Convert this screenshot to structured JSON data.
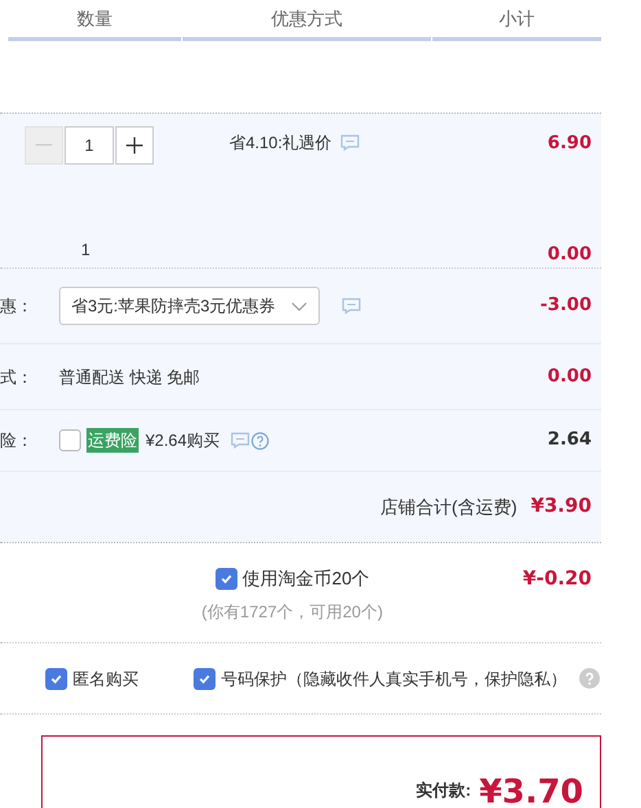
{
  "columns": [
    "数量",
    "优惠方式",
    "小计"
  ],
  "item": {
    "quantity": "1",
    "discount": "省4.10:礼遇价",
    "subtotal": "6.90"
  },
  "gift": {
    "quantity": "1",
    "subtotal": "0.00"
  },
  "coupon": {
    "label": "惠：",
    "value": "省3元:苹果防摔壳3元优惠券",
    "amount": "-3.00"
  },
  "delivery": {
    "label": "式：",
    "value": "普通配送 快递 免邮",
    "amount": "0.00"
  },
  "insurance": {
    "label": "险：",
    "checked": false,
    "badge": "运费险",
    "price": "¥2.64购买",
    "amount": "2.64"
  },
  "shop_total": {
    "label": "店铺合计(含运费)",
    "amount": "¥3.90"
  },
  "coins": {
    "checked": true,
    "label": "使用淘金币20个",
    "note": "(你有1727个，可用20个)",
    "amount": "¥-0.20"
  },
  "options": [
    {
      "label": "匿名购买",
      "checked": true
    },
    {
      "label": "号码保护（隐藏收件人真实手机号，保护隐私）",
      "checked": true
    }
  ],
  "pay": {
    "label": "实付款:",
    "amount": "¥3.70"
  }
}
